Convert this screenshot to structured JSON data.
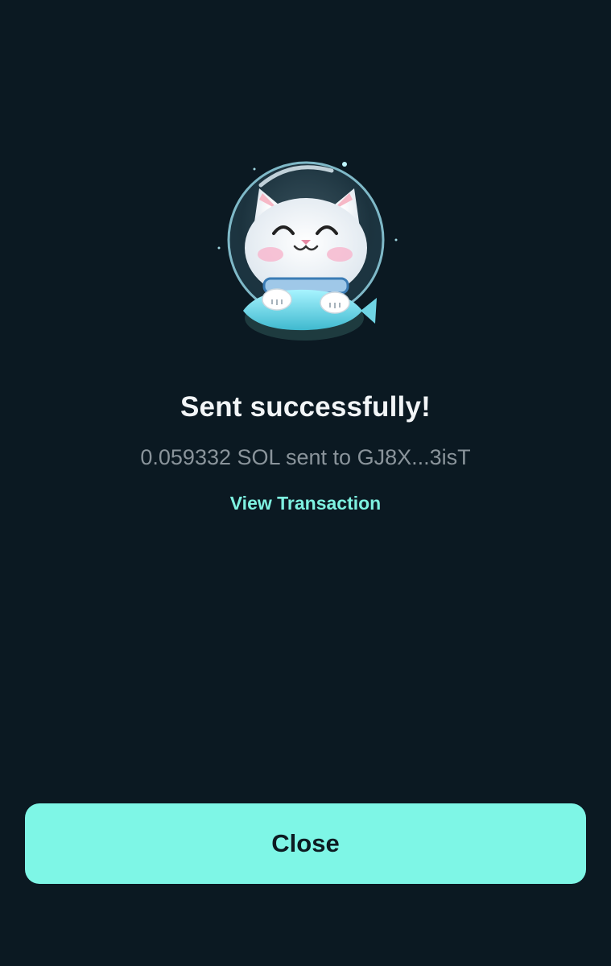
{
  "success": {
    "title": "Sent successfully!",
    "message": "0.059332 SOL sent to GJ8X...3isT",
    "view_link": "View Transaction"
  },
  "actions": {
    "close_label": "Close"
  },
  "mascot": {
    "icon": "astronaut-cat-illustration"
  },
  "colors": {
    "background": "#0b1922",
    "accent": "#7ef6e6",
    "link": "#7ef1e0",
    "title": "#f2f5f7",
    "muted": "#8a949b"
  }
}
